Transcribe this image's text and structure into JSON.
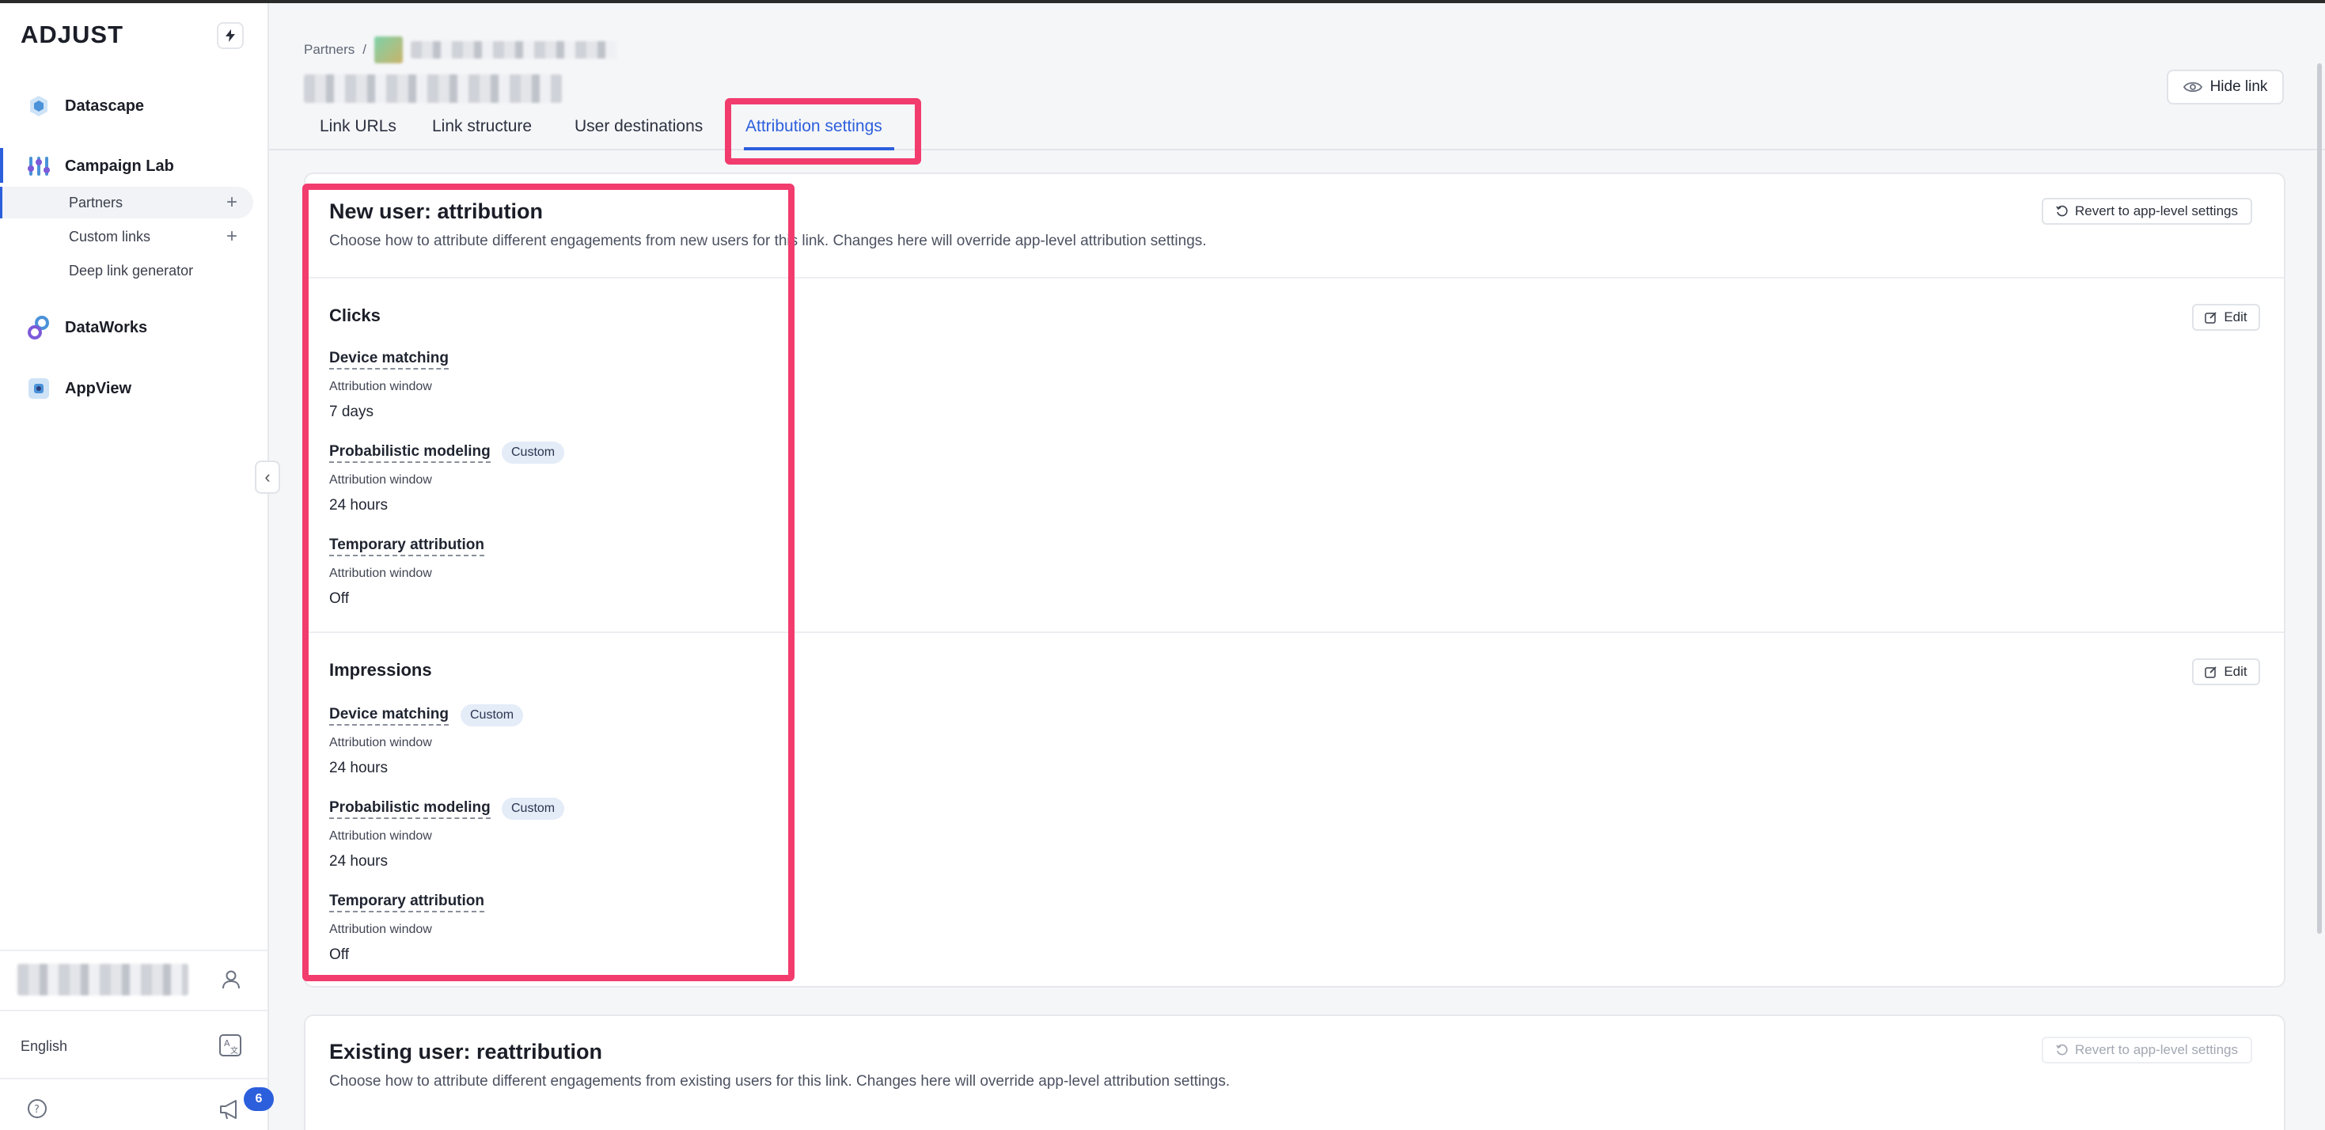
{
  "sidebar": {
    "logo": "ADJUST",
    "nav": [
      {
        "label": "Datascape",
        "icon": "datascape-icon"
      },
      {
        "label": "Campaign Lab",
        "icon": "campaign-lab-icon"
      },
      {
        "label": "DataWorks",
        "icon": "dataworks-icon"
      },
      {
        "label": "AppView",
        "icon": "appview-icon"
      }
    ],
    "sub_items": [
      {
        "label": "Partners",
        "has_add": true,
        "active": true
      },
      {
        "label": "Custom links",
        "has_add": true,
        "active": false
      },
      {
        "label": "Deep link generator",
        "has_add": false,
        "active": false
      }
    ],
    "language": "English",
    "notification_count": "6"
  },
  "breadcrumb": {
    "root": "Partners",
    "separator": "/"
  },
  "header": {
    "hide_link_label": "Hide link"
  },
  "tabs": [
    {
      "label": "Link URLs"
    },
    {
      "label": "Link structure"
    },
    {
      "label": "User destinations"
    },
    {
      "label": "Attribution settings",
      "active": true
    }
  ],
  "new_user": {
    "title": "New user: attribution",
    "description": "Choose how to attribute different engagements from new users for this link. Changes here will override app-level attribution settings.",
    "revert_label": "Revert to app-level settings",
    "edit_label": "Edit",
    "window_label": "Attribution window",
    "custom_tag": "Custom",
    "clicks": {
      "title": "Clicks",
      "items": [
        {
          "name": "Device matching",
          "value": "7 days",
          "custom": false
        },
        {
          "name": "Probabilistic modeling",
          "value": "24 hours",
          "custom": true
        },
        {
          "name": "Temporary attribution",
          "value": "Off",
          "custom": false
        }
      ]
    },
    "impressions": {
      "title": "Impressions",
      "items": [
        {
          "name": "Device matching",
          "value": "24 hours",
          "custom": true
        },
        {
          "name": "Probabilistic modeling",
          "value": "24 hours",
          "custom": true
        },
        {
          "name": "Temporary attribution",
          "value": "Off",
          "custom": false
        }
      ]
    }
  },
  "existing_user": {
    "title": "Existing user: reattribution",
    "description": "Choose how to attribute different engagements from existing users for this link. Changes here will override app-level attribution settings.",
    "revert_label": "Revert to app-level settings"
  },
  "colors": {
    "accent": "#2c5fdc",
    "highlight": "#f23c6e",
    "tag_bg": "#e4ecf8"
  }
}
